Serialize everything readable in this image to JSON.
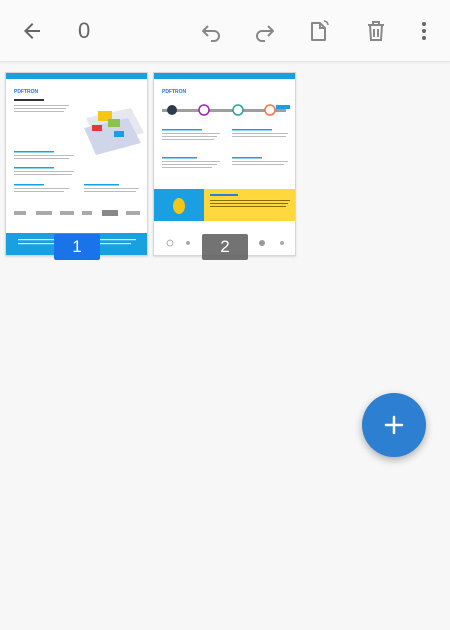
{
  "toolbar": {
    "selected_count": "0",
    "icons": [
      "back-arrow-icon",
      "undo-icon",
      "redo-icon",
      "rotate-page-icon",
      "delete-icon",
      "more-vert-icon"
    ]
  },
  "pages": [
    {
      "number": "1",
      "brand": "PDFTRON",
      "selected": true
    },
    {
      "number": "2",
      "brand": "PDFTRON",
      "selected": false
    }
  ],
  "fab": {
    "icon": "plus-icon"
  },
  "colors": {
    "accent": "#1a73e8",
    "fab": "#2d7fd1",
    "page_header": "#1aa0e0",
    "tech_banner": "#ffd83d"
  }
}
